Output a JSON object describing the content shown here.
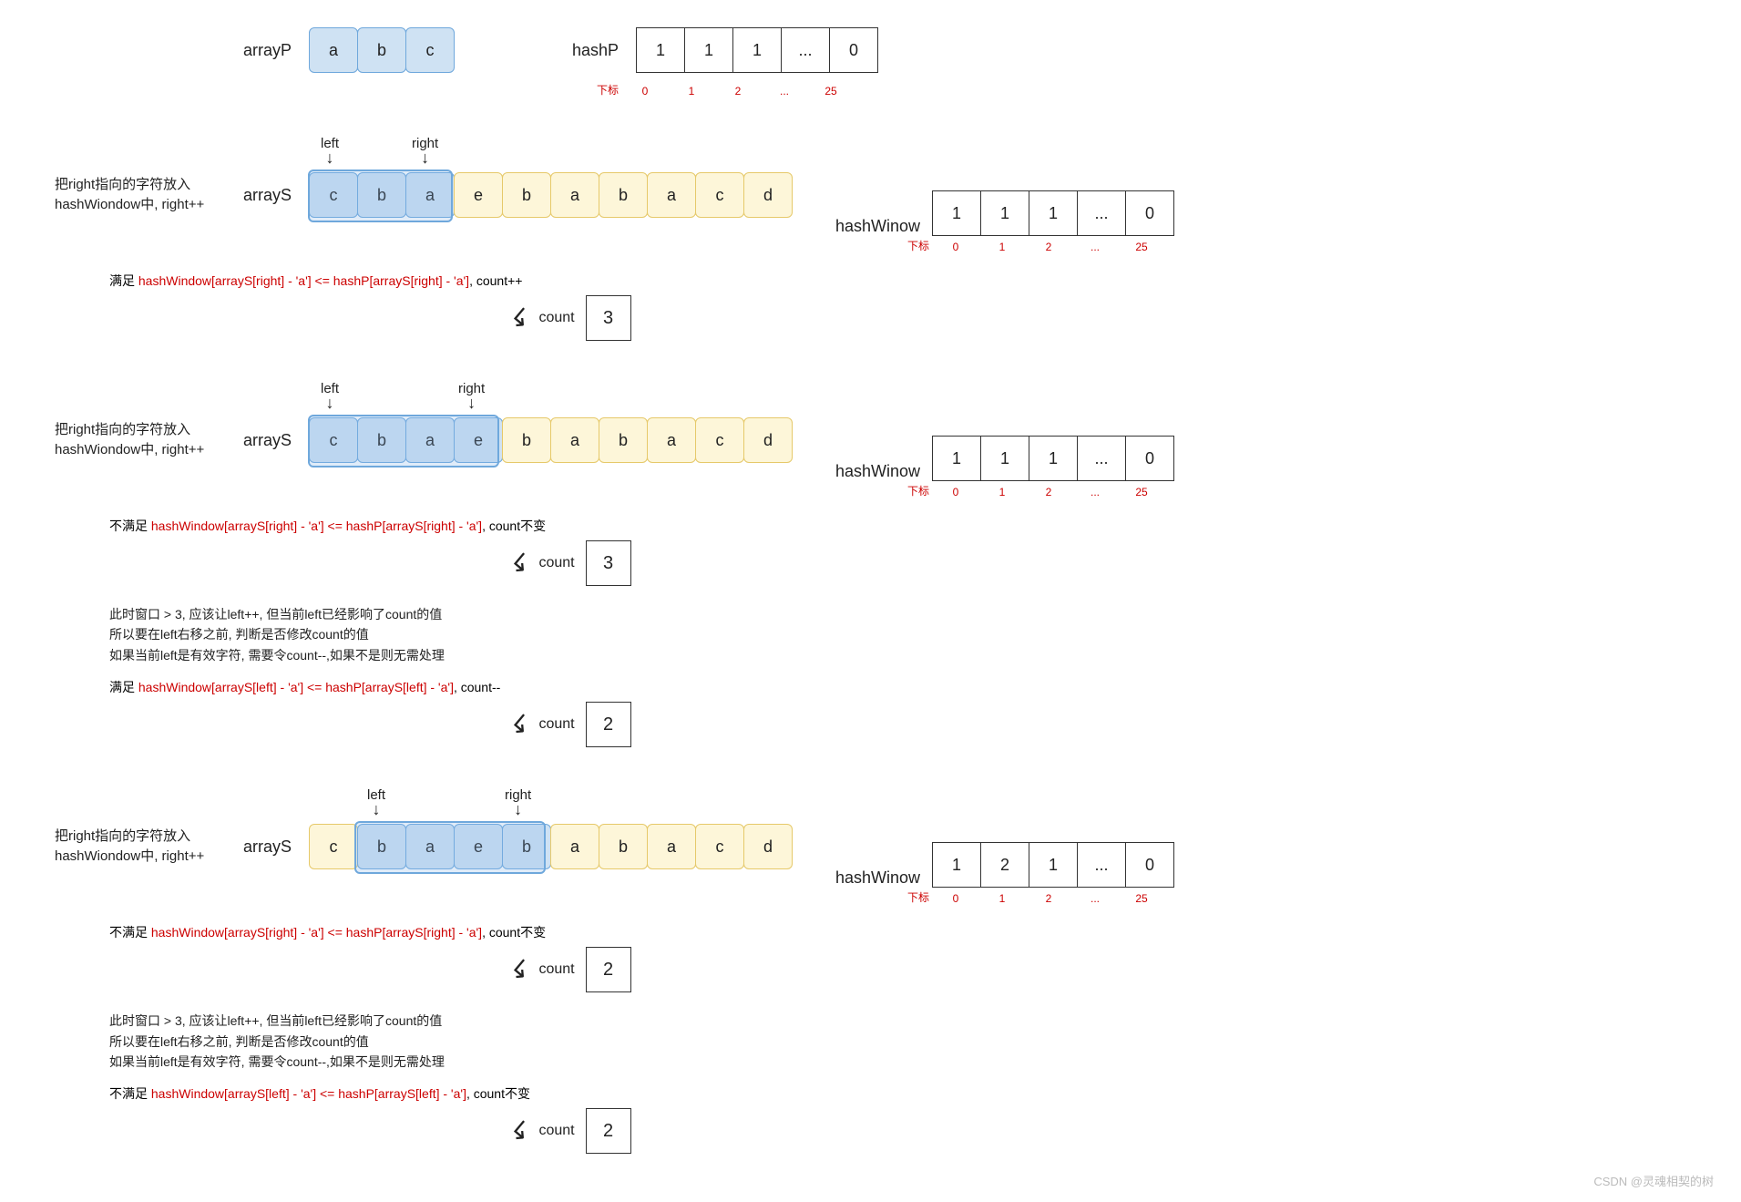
{
  "topRow": {
    "arrayP": {
      "label": "arrayP",
      "cells": [
        "a",
        "b",
        "c"
      ]
    },
    "hashP": {
      "label": "hashP",
      "cells": [
        "1",
        "1",
        "1",
        "...",
        "0"
      ],
      "idxLabel": "下标",
      "idx": [
        "0",
        "1",
        "2",
        "...",
        "25"
      ]
    }
  },
  "pointers": {
    "left": "left",
    "right": "right"
  },
  "arraySCells": [
    "c",
    "b",
    "a",
    "e",
    "b",
    "a",
    "b",
    "a",
    "c",
    "d"
  ],
  "arraySLabel": "arrayS",
  "desc": "把right指向的字符放入 hashWiondow中, right++",
  "hashWLabel": "hashWinow",
  "hashWIdxLabel": "下标",
  "hashWIdx": [
    "0",
    "1",
    "2",
    "...",
    "25"
  ],
  "countLabel": "count",
  "sections": [
    {
      "windowStart": 0,
      "windowEnd": 2,
      "leftPos": 0,
      "rightPos": 2,
      "hashW": [
        "1",
        "1",
        "1",
        "...",
        "0"
      ],
      "conds": [
        {
          "pre": "满足 ",
          "red": "hashWindow[arrayS[right] - 'a'] <= hashP[arrayS[right] - 'a']",
          "post": ", count++",
          "count": "3",
          "showCount": true
        }
      ]
    },
    {
      "windowStart": 0,
      "windowEnd": 3,
      "leftPos": 0,
      "rightPos": 3,
      "hashW": [
        "1",
        "1",
        "1",
        "...",
        "0"
      ],
      "conds": [
        {
          "pre": "不满足 ",
          "red": "hashWindow[arrayS[right] - 'a'] <= hashP[arrayS[right] - 'a']",
          "post": ", count不变",
          "count": "3",
          "showCount": true
        }
      ],
      "para": "此时窗口 > 3, 应该让left++, 但当前left已经影响了count的值\n所以要在left右移之前, 判断是否修改count的值\n如果当前left是有效字符, 需要令count--,如果不是则无需处理",
      "conds2": [
        {
          "pre": "满足 ",
          "red": "hashWindow[arrayS[left] - 'a'] <= hashP[arrayS[left] - 'a']",
          "post": ", count--",
          "count": "2",
          "showCount": true
        }
      ]
    },
    {
      "windowStart": 1,
      "windowEnd": 4,
      "leftPos": 1,
      "rightPos": 4,
      "hashW": [
        "1",
        "2",
        "1",
        "...",
        "0"
      ],
      "conds": [
        {
          "pre": "不满足 ",
          "red": "hashWindow[arrayS[right] - 'a'] <= hashP[arrayS[right] - 'a']",
          "post": ", count不变",
          "count": "2",
          "showCount": true
        }
      ],
      "para": "此时窗口 > 3, 应该让left++, 但当前left已经影响了count的值\n所以要在left右移之前, 判断是否修改count的值\n如果当前left是有效字符, 需要令count--,如果不是则无需处理",
      "conds2": [
        {
          "pre": "不满足 ",
          "red": "hashWindow[arrayS[left] - 'a'] <= hashP[arrayS[left] - 'a']",
          "post": ", count不变",
          "count": "2",
          "showCount": true
        }
      ]
    }
  ],
  "watermark": "CSDN @灵魂相契的树"
}
